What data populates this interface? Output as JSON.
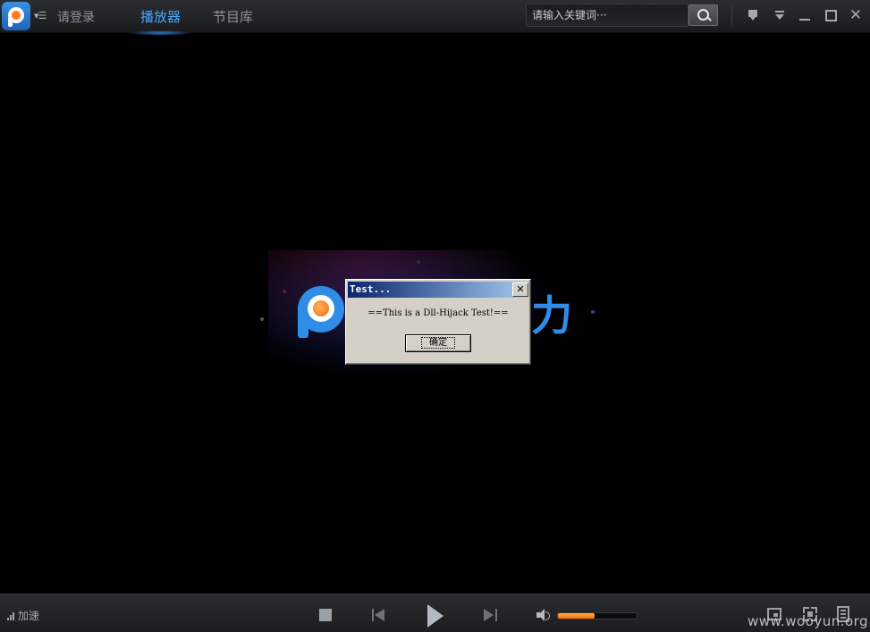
{
  "header": {
    "login_label": "请登录",
    "tabs": [
      {
        "label": "播放器",
        "active": true
      },
      {
        "label": "节目库",
        "active": false
      }
    ],
    "search": {
      "placeholder": "请输入关键词···"
    }
  },
  "center": {
    "brand_char": "力"
  },
  "dialog": {
    "title": "Test...",
    "close_label": "✕",
    "message": "==This is a Dll-Hijack Test!==",
    "ok_label": "确定"
  },
  "footer": {
    "speed_label": "加速",
    "volume_fraction": 0.47
  },
  "watermark": "www.wooyun.org",
  "colors": {
    "accent": "#4aa6ff",
    "brand_blue": "#2f8de8",
    "volume_orange": "#ff7a1a"
  }
}
